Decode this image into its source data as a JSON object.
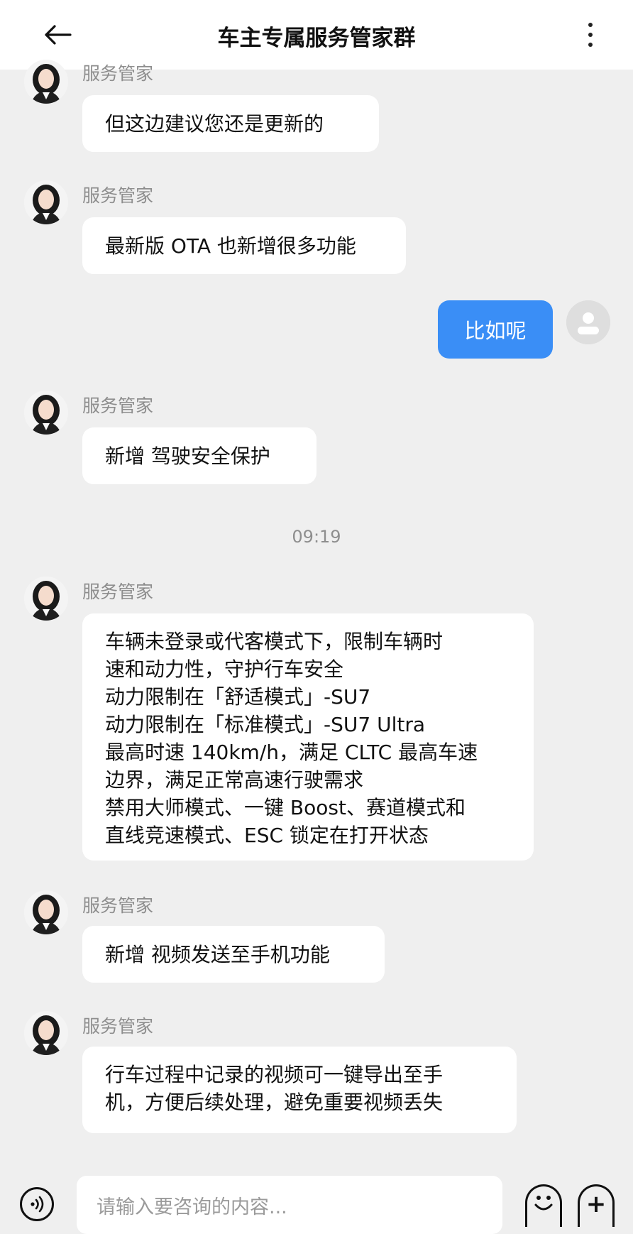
{
  "header": {
    "title": "车主专属服务管家群"
  },
  "sender_name": "服务管家",
  "messages": [
    {
      "text": "但这边建议您还是更新的"
    },
    {
      "text": "最新版 OTA 也新增很多功能"
    },
    {
      "text": "新增 驾驶安全保护"
    },
    {
      "lines": [
        "车辆未登录或代客模式下，限制车辆时",
        "速和动力性，守护行车安全",
        "动力限制在「舒适模式」-SU7",
        "动力限制在「标准模式」-SU7 Ultra",
        "最高时速 140km/h，满足 CLTC 最高车速",
        "边界，满足正常高速行驶需求",
        "禁用大师模式、一键 Boost、赛道模式和",
        "直线竞速模式、ESC 锁定在打开状态"
      ]
    },
    {
      "text": "新增 视频发送至手机功能"
    },
    {
      "lines": [
        "行车过程中记录的视频可一键导出至手",
        "机，方便后续处理，避免重要视频丢失"
      ]
    }
  ],
  "my_message": {
    "text": "比如呢"
  },
  "timestamp": "09:19",
  "input": {
    "placeholder": "请输入要咨询的内容..."
  },
  "colors": {
    "accent": "#3a8ef6",
    "background": "#efefef",
    "bubble": "#ffffff"
  },
  "icons": [
    "back-arrow-icon",
    "more-vertical-icon",
    "user-placeholder-icon",
    "voice-icon",
    "emoji-icon",
    "plus-icon"
  ]
}
